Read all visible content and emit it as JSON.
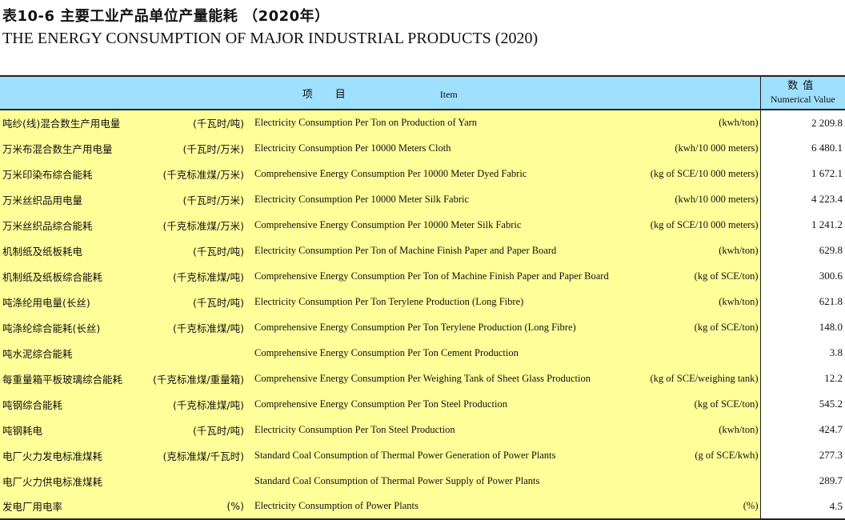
{
  "title_cn": "表10-6   主要工业产品单位产量能耗 （2020年）",
  "title_en": "THE ENERGY CONSUMPTION OF MAJOR INDUSTRIAL PRODUCTS (2020)",
  "header": {
    "item_cn": "项目",
    "item_en": "Item",
    "value_cn": "数值",
    "value_en": "Numerical Value"
  },
  "rows": [
    {
      "cn": "吨纱(线)混合数生产用电量",
      "cn_unit": "(千瓦时/吨)",
      "en": "Electricity Consumption Per Ton on Production of Yarn",
      "en_unit": "(kwh/ton)",
      "value": "2 209.8"
    },
    {
      "cn": "万米布混合数生产用电量",
      "cn_unit": "(千瓦时/万米)",
      "en": "Electricity Consumption Per 10000 Meters Cloth",
      "en_unit": "(kwh/10 000 meters)",
      "value": "6 480.1"
    },
    {
      "cn": "万米印染布综合能耗",
      "cn_unit": "(千克标准煤/万米)",
      "en": "Comprehensive Energy Consumption Per 10000 Meter Dyed Fabric",
      "en_unit": "(kg of SCE/10 000 meters)",
      "value": "1 672.1"
    },
    {
      "cn": "万米丝织品用电量",
      "cn_unit": "(千瓦时/万米)",
      "en": "Electricity Consumption Per 10000 Meter Silk Fabric",
      "en_unit": "(kwh/10 000 meters)",
      "value": "4 223.4"
    },
    {
      "cn": "万米丝织品综合能耗",
      "cn_unit": "(千克标准煤/万米)",
      "en": "Comprehensive Energy Consumption Per 10000 Meter Silk Fabric",
      "en_unit": "(kg of SCE/10 000 meters)",
      "value": "1 241.2"
    },
    {
      "cn": "机制纸及纸板耗电",
      "cn_unit": "(千瓦时/吨)",
      "en": "Electricity Consumption Per Ton of Machine Finish Paper and Paper Board",
      "en_unit": "(kwh/ton)",
      "value": "629.8"
    },
    {
      "cn": "机制纸及纸板综合能耗",
      "cn_unit": "(千克标准煤/吨)",
      "en": "Comprehensive Energy Consumption Per Ton of Machine Finish Paper and Paper Board",
      "en_unit": "(kg of SCE/ton)",
      "value": "300.6"
    },
    {
      "cn": "吨涤纶用电量(长丝)",
      "cn_unit": "(千瓦时/吨)",
      "en": "Electricity Consumption Per Ton Terylene Production (Long Fibre)",
      "en_unit": "(kwh/ton)",
      "value": "621.8"
    },
    {
      "cn": "吨涤纶综合能耗(长丝)",
      "cn_unit": "(千克标准煤/吨)",
      "en": "Comprehensive Energy Consumption Per Ton Terylene Production (Long Fibre)",
      "en_unit": "(kg of SCE/ton)",
      "value": "148.0"
    },
    {
      "cn": "吨水泥综合能耗",
      "cn_unit": "",
      "en": "Comprehensive Energy Consumption Per Ton Cement Production",
      "en_unit": "",
      "value": "3.8"
    },
    {
      "cn": "每重量箱平板玻璃综合能耗",
      "cn_unit": "(千克标准煤/重量箱)",
      "en": "Comprehensive Energy Consumption Per Weighing Tank of Sheet Glass Production",
      "en_unit": "(kg of SCE/weighing tank)",
      "value": "12.2"
    },
    {
      "cn": "吨钢综合能耗",
      "cn_unit": "(千克标准煤/吨)",
      "en": "Comprehensive Energy Consumption Per Ton Steel Production",
      "en_unit": "(kg of SCE/ton)",
      "value": "545.2"
    },
    {
      "cn": "吨钢耗电",
      "cn_unit": "(千瓦时/吨)",
      "en": "Electricity Consumption Per Ton Steel Production",
      "en_unit": "(kwh/ton)",
      "value": "424.7"
    },
    {
      "cn": "电厂火力发电标准煤耗",
      "cn_unit": "(克标准煤/千瓦时)",
      "en": "Standard Coal Consumption of  Thermal Power Generation of Power Plants",
      "en_unit": "(g of SCE/kwh)",
      "value": "277.3"
    },
    {
      "cn": "电厂火力供电标准煤耗",
      "cn_unit": "",
      "en": "Standard Coal Consumption of  Thermal Power Supply of Power Plants",
      "en_unit": "",
      "value": "289.7"
    },
    {
      "cn": "发电厂用电率",
      "cn_unit": "(%)",
      "en": "Electricity Consumption of Power Plants",
      "en_unit": "(%)",
      "value": "4.5"
    }
  ]
}
